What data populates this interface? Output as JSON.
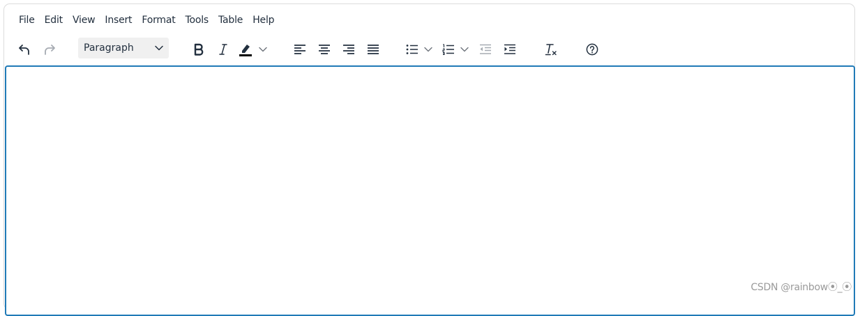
{
  "menubar": {
    "items": [
      "File",
      "Edit",
      "View",
      "Insert",
      "Format",
      "Tools",
      "Table",
      "Help"
    ]
  },
  "toolbar": {
    "block_format": "Paragraph",
    "buttons": [
      {
        "name": "undo-icon"
      },
      {
        "name": "redo-icon",
        "disabled": true
      },
      {
        "name": "bold-icon"
      },
      {
        "name": "italic-icon"
      },
      {
        "name": "highlight-color-icon"
      },
      {
        "name": "align-left-icon"
      },
      {
        "name": "align-center-icon"
      },
      {
        "name": "align-right-icon"
      },
      {
        "name": "align-justify-icon"
      },
      {
        "name": "bullet-list-icon"
      },
      {
        "name": "numbered-list-icon"
      },
      {
        "name": "outdent-icon",
        "disabled": true
      },
      {
        "name": "indent-icon"
      },
      {
        "name": "clear-formatting-icon"
      },
      {
        "name": "help-icon"
      }
    ]
  },
  "content": {
    "text": ""
  },
  "watermark": "CSDN @rainbow⦿_⦿",
  "colors": {
    "focus_border": "#207ab7",
    "icon": "#222f3e",
    "disabled_icon": "#a6abb2",
    "select_bg": "#f0f0f0"
  }
}
